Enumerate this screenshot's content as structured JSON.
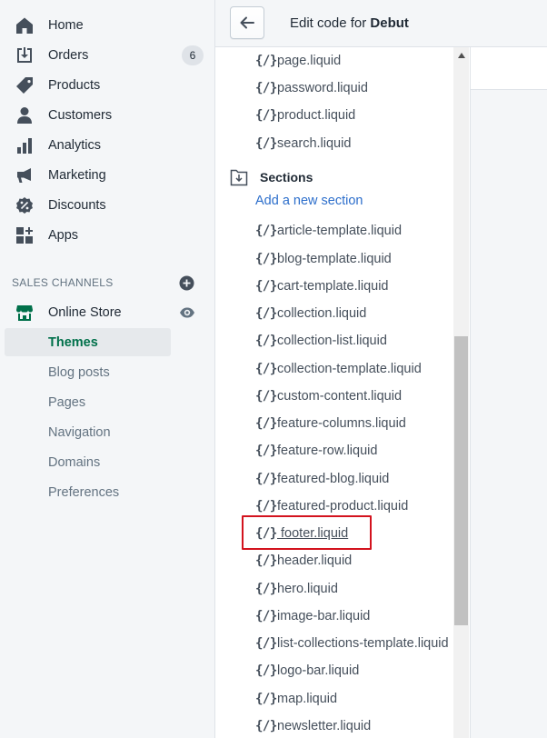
{
  "nav": {
    "items": [
      {
        "label": "Home",
        "icon": "home-icon"
      },
      {
        "label": "Orders",
        "icon": "orders-icon",
        "badge": "6"
      },
      {
        "label": "Products",
        "icon": "tag-icon"
      },
      {
        "label": "Customers",
        "icon": "person-icon"
      },
      {
        "label": "Analytics",
        "icon": "bar-chart-icon"
      },
      {
        "label": "Marketing",
        "icon": "megaphone-icon"
      },
      {
        "label": "Discounts",
        "icon": "discount-icon"
      },
      {
        "label": "Apps",
        "icon": "apps-icon"
      }
    ],
    "sales_channels_heading": "SALES CHANNELS",
    "online_store": {
      "label": "Online Store",
      "icon": "store-icon"
    },
    "online_store_sub": [
      "Themes",
      "Blog posts",
      "Pages",
      "Navigation",
      "Domains",
      "Preferences"
    ],
    "active_sub": "Themes"
  },
  "topbar": {
    "title_prefix": "Edit code for",
    "theme_name": "Debut"
  },
  "files": {
    "templates_tail": [
      "page.liquid",
      "password.liquid",
      "product.liquid",
      "search.liquid"
    ],
    "sections_title": "Sections",
    "add_section_label": "Add a new section",
    "sections": [
      "article-template.liquid",
      "blog-template.liquid",
      "cart-template.liquid",
      "collection.liquid",
      "collection-list.liquid",
      "collection-template.liquid",
      "custom-content.liquid",
      "feature-columns.liquid",
      "feature-row.liquid",
      "featured-blog.liquid",
      "featured-product.liquid",
      " footer.liquid",
      "header.liquid",
      "hero.liquid",
      "image-bar.liquid",
      "list-collections-template.liquid",
      "logo-bar.liquid",
      "map.liquid",
      "newsletter.liquid"
    ],
    "file_icon_glyph": "{/}",
    "highlighted_file": "footer.liquid"
  },
  "colors": {
    "accent_green": "#00704a",
    "link_blue": "#2c6ecb",
    "highlight_red": "#d3131e"
  }
}
